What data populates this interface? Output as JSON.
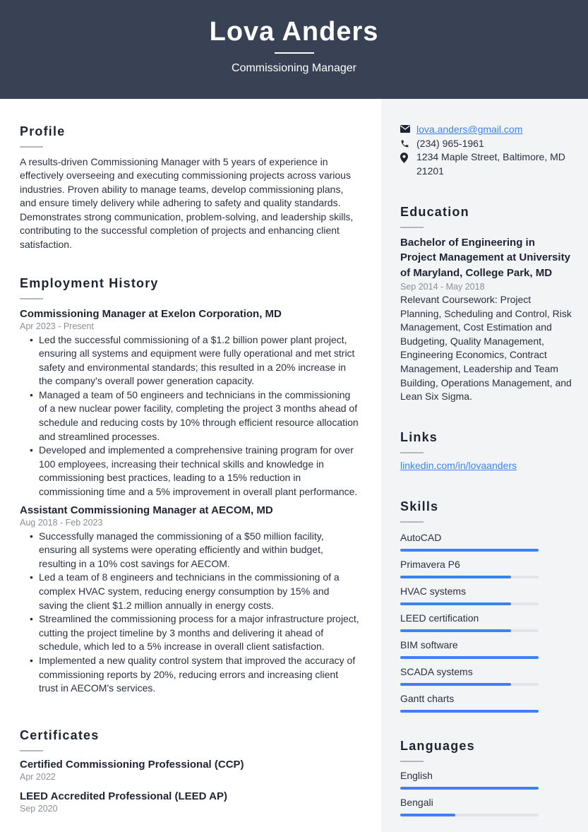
{
  "header": {
    "name": "Lova Anders",
    "job_title": "Commissioning Manager"
  },
  "profile": {
    "title": "Profile",
    "text": "A results-driven Commissioning Manager with 5 years of experience in effectively overseeing and executing commissioning projects across various industries. Proven ability to manage teams, develop commissioning plans, and ensure timely delivery while adhering to safety and quality standards. Demonstrates strong communication, problem-solving, and leadership skills, contributing to the successful completion of projects and enhancing client satisfaction."
  },
  "employment": {
    "title": "Employment History",
    "jobs": [
      {
        "title": "Commissioning Manager at Exelon Corporation, MD",
        "dates": "Apr 2023 - Present",
        "bullets": [
          "Led the successful commissioning of a $1.2 billion power plant project, ensuring all systems and equipment were fully operational and met strict safety and environmental standards; this resulted in a 20% increase in the company's overall power generation capacity.",
          "Managed a team of 50 engineers and technicians in the commissioning of a new nuclear power facility, completing the project 3 months ahead of schedule and reducing costs by 10% through efficient resource allocation and streamlined processes.",
          "Developed and implemented a comprehensive training program for over 100 employees, increasing their technical skills and knowledge in commissioning best practices, leading to a 15% reduction in commissioning time and a 5% improvement in overall plant performance."
        ]
      },
      {
        "title": "Assistant Commissioning Manager at AECOM, MD",
        "dates": "Aug 2018 - Feb 2023",
        "bullets": [
          "Successfully managed the commissioning of a $50 million facility, ensuring all systems were operating efficiently and within budget, resulting in a 10% cost savings for AECOM.",
          "Led a team of 8 engineers and technicians in the commissioning of a complex HVAC system, reducing energy consumption by 15% and saving the client $1.2 million annually in energy costs.",
          "Streamlined the commissioning process for a major infrastructure project, cutting the project timeline by 3 months and delivering it ahead of schedule, which led to a 5% increase in overall client satisfaction.",
          "Implemented a new quality control system that improved the accuracy of commissioning reports by 20%, reducing errors and increasing client trust in AECOM's services."
        ]
      }
    ]
  },
  "certificates": {
    "title": "Certificates",
    "items": [
      {
        "name": "Certified Commissioning Professional (CCP)",
        "date": "Apr 2022"
      },
      {
        "name": "LEED Accredited Professional (LEED AP)",
        "date": "Sep 2020"
      }
    ]
  },
  "contact": {
    "email": "lova.anders@gmail.com",
    "phone": "(234) 965-1961",
    "address": "1234 Maple Street, Baltimore, MD 21201",
    "icons": {
      "email": "envelope-icon",
      "phone": "phone-icon",
      "address": "map-pin-icon"
    }
  },
  "education": {
    "title": "Education",
    "degree": "Bachelor of Engineering in Project Management at University of Maryland, College Park, MD",
    "dates": "Sep 2014 - May 2018",
    "description": "Relevant Coursework: Project Planning, Scheduling and Control, Risk Management, Cost Estimation and Budgeting, Quality Management, Engineering Economics, Contract Management, Leadership and Team Building, Operations Management, and Lean Six Sigma."
  },
  "links": {
    "title": "Links",
    "items": [
      {
        "label": "linkedin.com/in/lovaanders"
      }
    ]
  },
  "skills": {
    "title": "Skills",
    "items": [
      {
        "name": "AutoCAD",
        "level": 1.0
      },
      {
        "name": "Primavera P6",
        "level": 0.8
      },
      {
        "name": "HVAC systems",
        "level": 0.8
      },
      {
        "name": "LEED certification",
        "level": 0.8
      },
      {
        "name": "BIM software",
        "level": 1.0
      },
      {
        "name": "SCADA systems",
        "level": 0.8
      },
      {
        "name": "Gantt charts",
        "level": 1.0
      }
    ]
  },
  "languages": {
    "title": "Languages",
    "items": [
      {
        "name": "English",
        "level": 1.0
      },
      {
        "name": "Bengali",
        "level": 0.4
      }
    ]
  },
  "colors": {
    "header_bg": "#384254",
    "sidebar_bg": "#f3f4f6",
    "accent": "#3b82f6",
    "text": "#1f2433",
    "muted": "#8a8f99"
  }
}
